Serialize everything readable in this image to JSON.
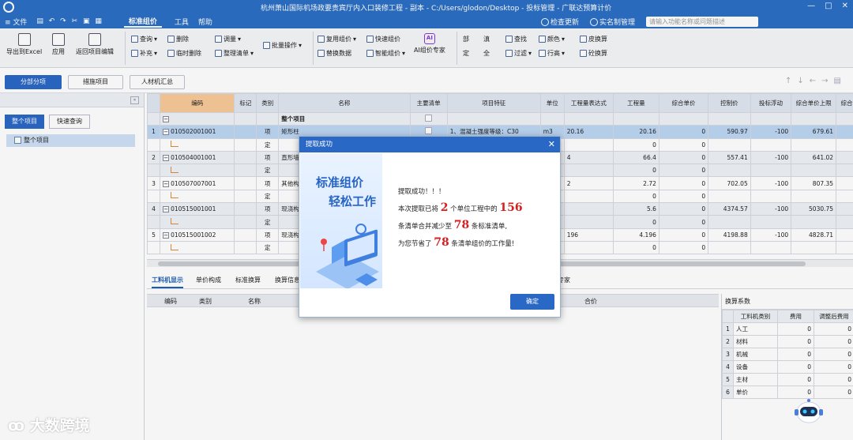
{
  "window": {
    "title": "杭州萧山国际机场政要贵宾厅内入口装修工程 - 副本 - C:/Users/glodon/Desktop - 投标管理 - 广联达预算计价",
    "controls": [
      "—",
      "□",
      "✕"
    ]
  },
  "menu": {
    "file": "≡ 文件",
    "quick_access": "▤ ↶ ↷ ✂ ▣ ▦",
    "items": [
      "标准组价",
      "工具",
      "帮助"
    ],
    "check_update": "检查更新",
    "realname": "实名制管理",
    "search_placeholder": "请输入功能名称或问题描述"
  },
  "ribbon": {
    "export_excel": "导出到Excel",
    "apply": "应用",
    "back_edit": "返回项目编辑",
    "query": "查询",
    "delete": "删除",
    "adjust_qty": "调量",
    "batch_ops": "批量操作",
    "supplement": "补充",
    "temp_delete": "临时删除",
    "organize_list": "整理清单",
    "reuse_price": "复用组价",
    "quick_price": "快速组价",
    "ai_price": "AI组价专家",
    "ai_badge": "AI",
    "replace_data": "替换数据",
    "smart_price": "智能组价",
    "fix1": "部",
    "fix2": "定",
    "fix3": "滇",
    "fix4": "全",
    "find": "查找",
    "filter": "过滤",
    "color": "颜色",
    "row_height": "行高",
    "conv_calc1": "皮换算",
    "conv_calc2": "砼换算"
  },
  "tabs": {
    "subitem": "分部分项",
    "measures": "措施项目",
    "labor_summary": "人材机汇总"
  },
  "left_panel": {
    "btn_whole": "整个项目",
    "btn_quick_query": "快速查询",
    "tree_root": "整个项目"
  },
  "grid": {
    "headers": [
      "编码",
      "标记",
      "类别",
      "名称",
      "主要清单",
      "项目特征",
      "单位",
      "工程量表达式",
      "工程量",
      "综合单价",
      "控制价",
      "投标浮动",
      "综合单价上限",
      "综合单价下限"
    ],
    "group_row": "整个项目",
    "rows": [
      {
        "n": "1",
        "code": "010502001001",
        "type": "项",
        "name": "矩形柱",
        "feature": "1、混凝土强度等级：C30",
        "unit": "m3",
        "expr": "20.16",
        "qty": "20.16",
        "price": "0",
        "ctrl": "590.97",
        "float": "-100",
        "upper": "679.61",
        "lower": "502."
      },
      {
        "n": "",
        "code": "",
        "type": "定",
        "name": "",
        "feature": "",
        "unit": "",
        "expr": "",
        "qty": "0",
        "price": "0",
        "ctrl": "",
        "float": "",
        "upper": "",
        "lower": ""
      },
      {
        "n": "2",
        "code": "010504001001",
        "type": "项",
        "name": "直形墙",
        "feature": "",
        "unit": "",
        "expr": "4",
        "qty": "66.4",
        "price": "0",
        "ctrl": "557.41",
        "float": "-100",
        "upper": "641.02",
        "lower": "473"
      },
      {
        "n": "",
        "code": "",
        "type": "定",
        "name": "",
        "feature": "",
        "unit": "",
        "expr": "",
        "qty": "0",
        "price": "0",
        "ctrl": "",
        "float": "",
        "upper": "",
        "lower": ""
      },
      {
        "n": "3",
        "code": "010507007001",
        "type": "项",
        "name": "其他构件",
        "feature": "",
        "unit": "",
        "expr": "2",
        "qty": "2.72",
        "price": "0",
        "ctrl": "702.05",
        "float": "-100",
        "upper": "807.35",
        "lower": "596."
      },
      {
        "n": "",
        "code": "",
        "type": "定",
        "name": "",
        "feature": "",
        "unit": "",
        "expr": "",
        "qty": "0",
        "price": "0",
        "ctrl": "",
        "float": "",
        "upper": "",
        "lower": ""
      },
      {
        "n": "4",
        "code": "010515001001",
        "type": "项",
        "name": "现浇构件",
        "feature": "",
        "unit": "",
        "expr": "",
        "qty": "5.6",
        "price": "0",
        "ctrl": "4374.57",
        "float": "-100",
        "upper": "5030.75",
        "lower": "3718."
      },
      {
        "n": "",
        "code": "",
        "type": "定",
        "name": "",
        "feature": "",
        "unit": "",
        "expr": "",
        "qty": "0",
        "price": "0",
        "ctrl": "",
        "float": "",
        "upper": "",
        "lower": ""
      },
      {
        "n": "5",
        "code": "010515001002",
        "type": "项",
        "name": "现浇构件",
        "feature": "",
        "unit": "",
        "expr": "196",
        "qty": "4.196",
        "price": "0",
        "ctrl": "4198.88",
        "float": "-100",
        "upper": "4828.71",
        "lower": "3569."
      },
      {
        "n": "",
        "code": "",
        "type": "定",
        "name": "",
        "feature": "",
        "unit": "",
        "expr": "",
        "qty": "0",
        "price": "0",
        "ctrl": "",
        "float": "",
        "upper": "",
        "lower": ""
      }
    ]
  },
  "bottom_tabs": [
    "工料机显示",
    "单价构成",
    "标准换算",
    "换算信息",
    "专家"
  ],
  "lower_headers": [
    "编码",
    "类别",
    "名称",
    "合价"
  ],
  "calc_panel": {
    "title": "换算系数",
    "headers": [
      "",
      "工料机类别",
      "费用",
      "调整后费用"
    ],
    "rows": [
      {
        "n": "1",
        "cat": "人工",
        "fee": "0",
        "adj": "0"
      },
      {
        "n": "2",
        "cat": "材料",
        "fee": "0",
        "adj": "0"
      },
      {
        "n": "3",
        "cat": "机械",
        "fee": "0",
        "adj": "0"
      },
      {
        "n": "4",
        "cat": "设备",
        "fee": "0",
        "adj": "0"
      },
      {
        "n": "5",
        "cat": "主材",
        "fee": "0",
        "adj": "0"
      },
      {
        "n": "6",
        "cat": "单价",
        "fee": "0",
        "adj": "0"
      }
    ]
  },
  "dialog": {
    "title": "提取成功",
    "slogan1": "标准组价",
    "slogan2": "轻松工作",
    "line1": "提取成功！！！",
    "t1": "本次提取已将",
    "units": "2",
    "t2": "个单位工程中的",
    "lists": "156",
    "t3": "条清单合并减少至",
    "reduced": "78",
    "t4": "条标准清单,",
    "t5": "为您节省了",
    "saved": "78",
    "t6": "条清单组价的工作量!",
    "ok": "确定"
  },
  "watermark": "大数跨境",
  "colors": {
    "brand": "#2b6fc4",
    "highlight": "#d42020",
    "selected_row": "#bcd6f3"
  }
}
